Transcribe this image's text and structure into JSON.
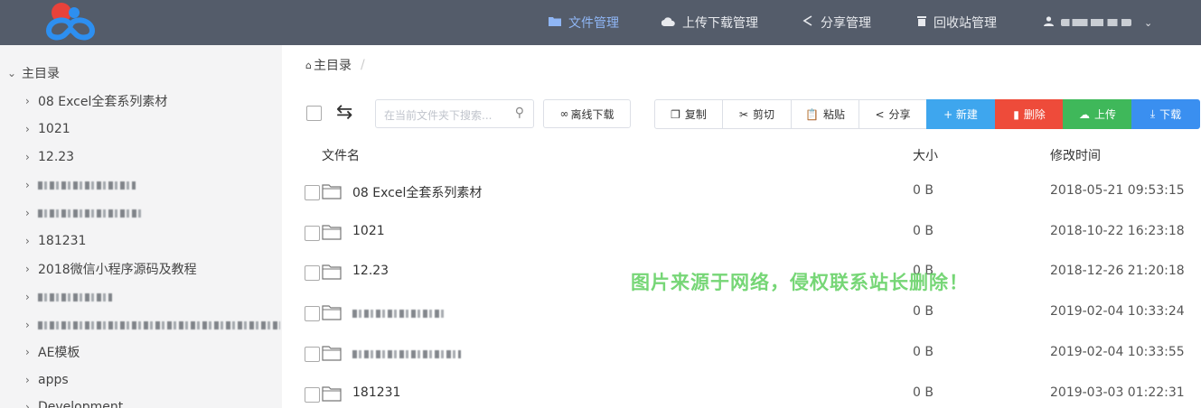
{
  "header": {
    "nav": [
      {
        "label": "文件管理",
        "icon": "folder-icon",
        "active": true
      },
      {
        "label": "上传下载管理",
        "icon": "cloud-icon",
        "active": false
      },
      {
        "label": "分享管理",
        "icon": "share-icon",
        "active": false
      },
      {
        "label": "回收站管理",
        "icon": "trash-icon",
        "active": false
      }
    ]
  },
  "sidebar": {
    "root": "主目录",
    "items": [
      {
        "label": "08 Excel全套系列素材"
      },
      {
        "label": "1021"
      },
      {
        "label": "12.23"
      },
      {
        "label": ""
      },
      {
        "label": ""
      },
      {
        "label": "181231"
      },
      {
        "label": "2018微信小程序源码及教程"
      },
      {
        "label": ""
      },
      {
        "label": ""
      },
      {
        "label": "AE模板"
      },
      {
        "label": "apps"
      },
      {
        "label": "Development"
      }
    ]
  },
  "breadcrumb": {
    "root": "主目录",
    "separator": "/"
  },
  "toolbar": {
    "search_placeholder": "在当前文件夹下搜索...",
    "offline_label": "离线下载",
    "copy_label": "复制",
    "cut_label": "剪切",
    "paste_label": "粘贴",
    "share_label": "分享",
    "new_label": "+ 新建",
    "delete_label": "删除",
    "upload_label": "上传",
    "download_label": "下载"
  },
  "table": {
    "columns": {
      "name": "文件名",
      "size": "大小",
      "time": "修改时间"
    },
    "rows": [
      {
        "name": "08 Excel全套系列素材",
        "size": "0 B",
        "time": "2018-05-21 09:53:15"
      },
      {
        "name": "1021",
        "size": "0 B",
        "time": "2018-10-22 16:23:18"
      },
      {
        "name": "12.23",
        "size": "0 B",
        "time": "2018-12-26 21:20:18"
      },
      {
        "name": "",
        "size": "0 B",
        "time": "2019-02-04 10:33:24"
      },
      {
        "name": "",
        "size": "0 B",
        "time": "2019-02-04 10:33:55"
      },
      {
        "name": "181231",
        "size": "0 B",
        "time": "2019-03-03 01:22:31"
      }
    ]
  },
  "watermark": "图片来源于网络，侵权联系站长删除！",
  "colors": {
    "topbar": "#545c6a",
    "accent": "#8fb6f5",
    "new": "#3ea6ee",
    "delete": "#ee4b3a",
    "upload": "#3fb85a",
    "download": "#3a8ff0"
  }
}
